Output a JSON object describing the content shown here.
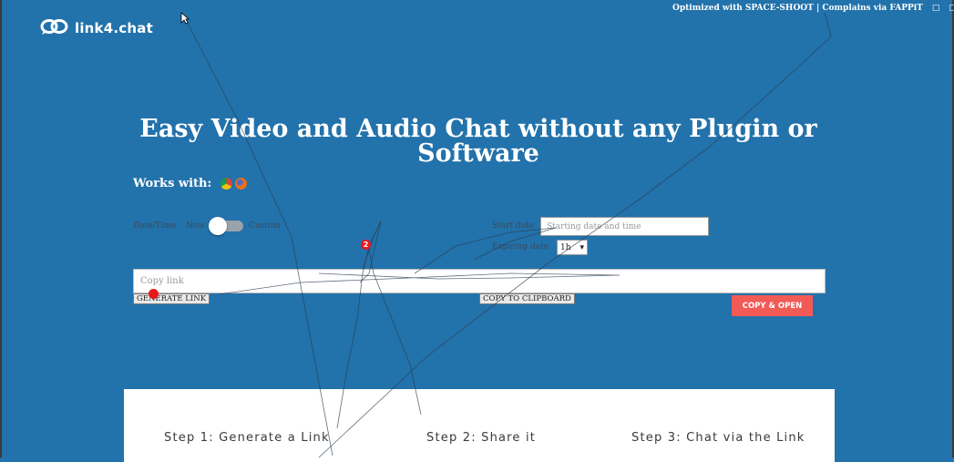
{
  "brand": {
    "name": "link4.chat"
  },
  "topbar": {
    "text": "Optimized with SPACE-SHOOT | Complains via FAPPiT",
    "icons": [
      "□",
      "□"
    ]
  },
  "hero": {
    "title": "Easy Video and Audio Chat without any Plugin or Software"
  },
  "works_with": {
    "label": "Works with:",
    "browsers": [
      "chrome-icon",
      "firefox-icon"
    ]
  },
  "form": {
    "datetime_label": "Date/Time",
    "now_label": "Now",
    "custom_label": "Custom",
    "start_date_label": "Start date",
    "start_date_placeholder": "Starting date and time",
    "start_date_value": "",
    "expiring_label": "Expiring date",
    "expiring_value": "1h",
    "expiring_arrow": "▾",
    "copy_link_placeholder": "Copy link",
    "copy_link_value": "",
    "generate_button": "GENERATE LINK",
    "clipboard_button": "COPY TO CLIPBOARD",
    "copy_open_button": "COPY & OPEN"
  },
  "markers": [
    "2"
  ],
  "steps": [
    "Step 1: Generate a Link",
    "Step 2: Share it",
    "Step 3: Chat via the Link"
  ],
  "colors": {
    "background": "#2272ab",
    "accent": "#f25a56",
    "marker": "#e8191b"
  }
}
